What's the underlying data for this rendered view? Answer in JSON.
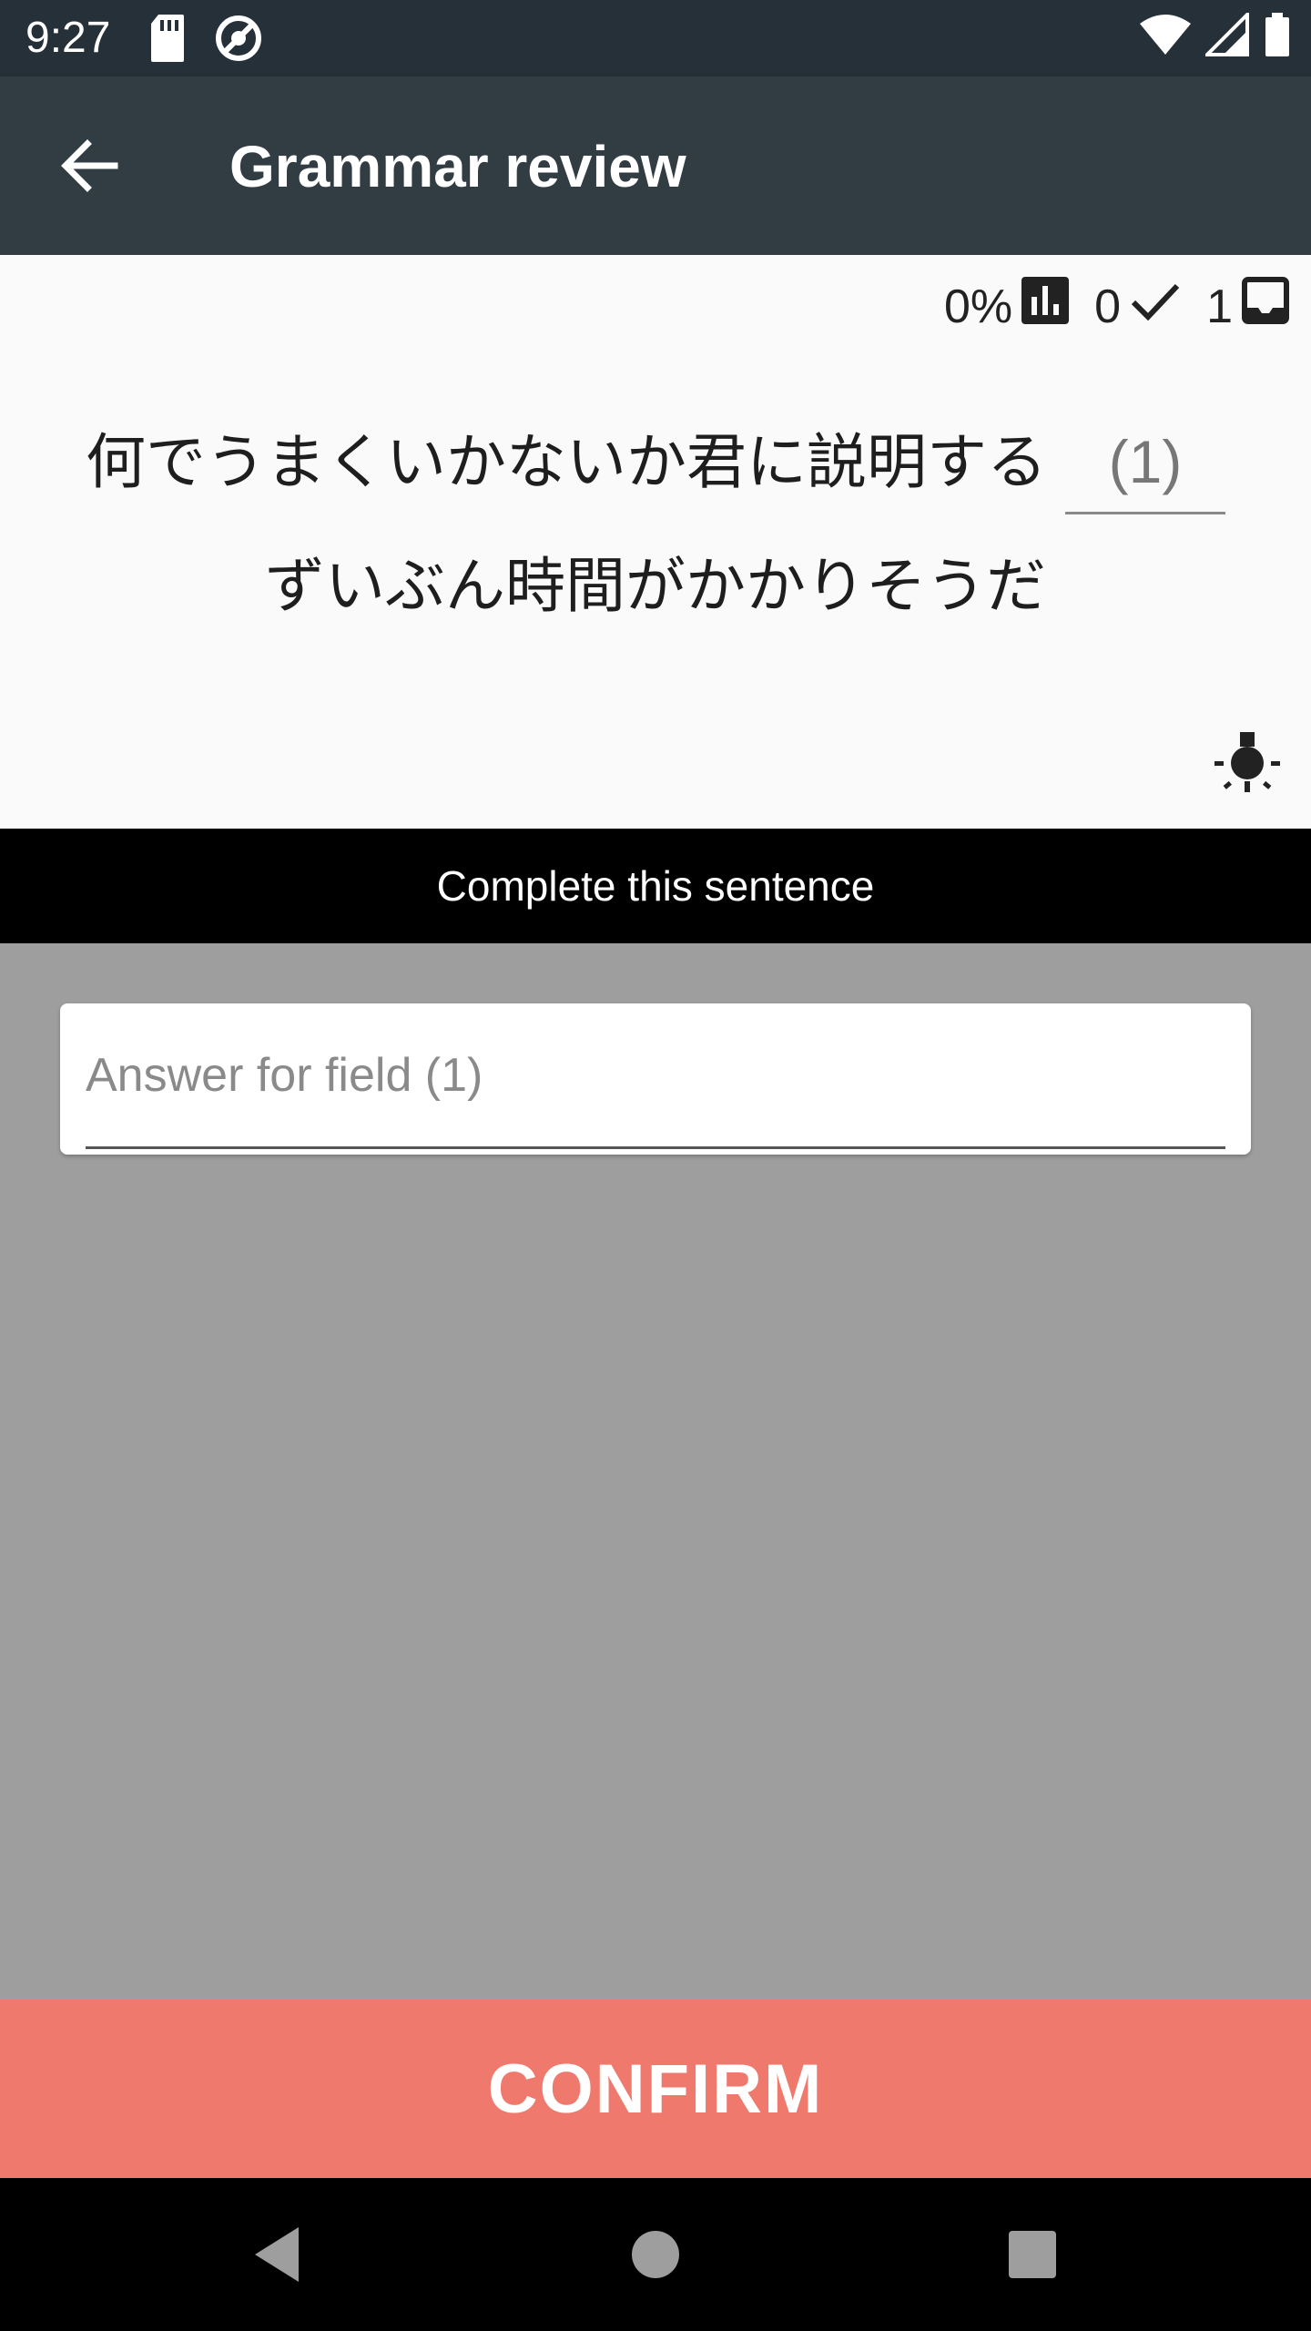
{
  "status_bar": {
    "time": "9:27",
    "left_icons": [
      "sd-card-icon",
      "sync-icon"
    ],
    "right_icons": [
      "wifi-icon",
      "signal-icon",
      "battery-icon"
    ]
  },
  "app_bar": {
    "back_icon": "arrow-back-icon",
    "title": "Grammar review"
  },
  "stats": {
    "progress": "0%",
    "progress_icon": "bar-chart-icon",
    "correct_count": "0",
    "correct_icon": "check-icon",
    "remaining_count": "1",
    "remaining_icon": "inbox-icon"
  },
  "sentence": {
    "line1": "何でうまくいかないか君に説明する",
    "blank": "(1)",
    "line2": "ずいぶん時間がかかりそうだ"
  },
  "hint_icon": "lightbulb-icon",
  "instruction": "Complete this sentence",
  "answer": {
    "value": "",
    "placeholder": "Answer for field (1)"
  },
  "confirm_label": "CONFIRM",
  "colors": {
    "status_bar": "#263038",
    "app_bar": "#323c43",
    "confirm": "#ef796c",
    "background": "#9e9e9e"
  },
  "nav_bar": {
    "icons": [
      "back-triangle-icon",
      "home-circle-icon",
      "recents-square-icon"
    ]
  }
}
